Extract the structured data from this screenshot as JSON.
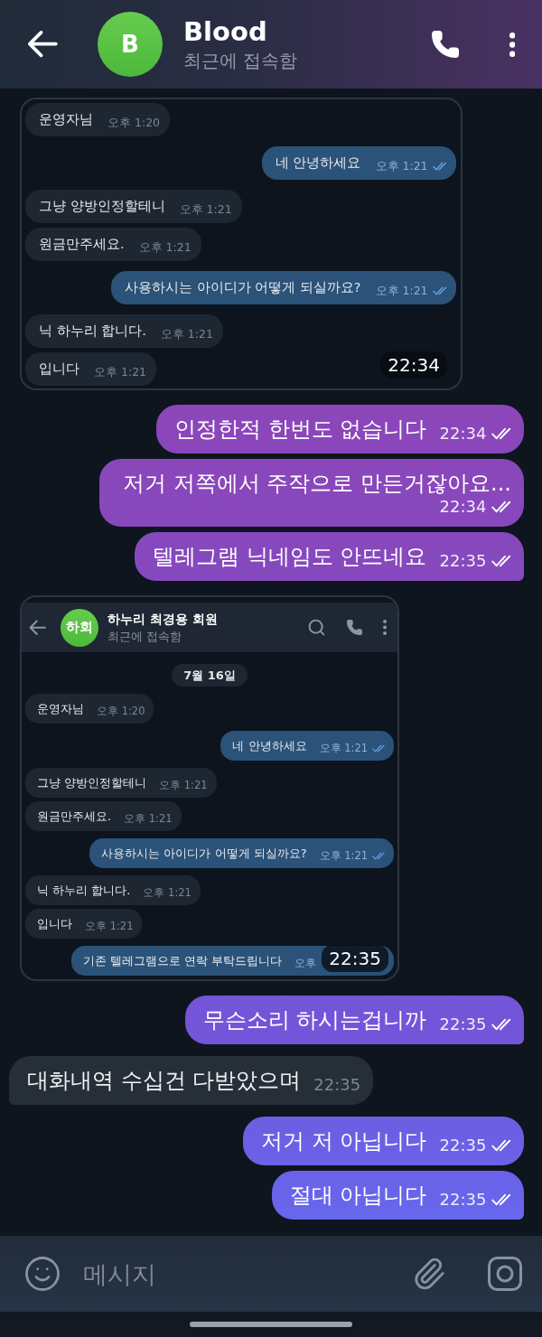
{
  "header": {
    "avatar_initial": "B",
    "title": "Blood",
    "status": "최근에 접속함"
  },
  "messages": [
    {
      "kind": "screenshot",
      "time": "22:34",
      "messages": [
        {
          "kind": "incoming",
          "text": "운영자님",
          "time": "오후 1:20"
        },
        {
          "kind": "outgoing",
          "text": "네 안녕하세요",
          "time": "오후 1:21",
          "read": true
        },
        {
          "kind": "incoming",
          "text": "그냥 양방인정할테니",
          "time": "오후 1:21"
        },
        {
          "kind": "incoming",
          "text": "원금만주세요.",
          "time": "오후 1:21"
        },
        {
          "kind": "outgoing",
          "text": "사용하시는 아이디가 어떻게 되실까요?",
          "time": "오후 1:21",
          "read": true
        },
        {
          "kind": "incoming",
          "text": "닉 하누리 합니다.",
          "time": "오후 1:21"
        },
        {
          "kind": "incoming",
          "text": "입니다",
          "time": "오후 1:21"
        }
      ]
    },
    {
      "kind": "outgoing",
      "text": "인정한적 한번도 없습니다",
      "time": "22:34",
      "read": true
    },
    {
      "kind": "outgoing",
      "text": "저거 저쪽에서 주작으로 만든거잖아요...",
      "time": "22:34",
      "read": true
    },
    {
      "kind": "outgoing",
      "text": "텔레그램 닉네임도 안뜨네요",
      "time": "22:35",
      "read": true
    },
    {
      "kind": "screenshot",
      "time": "22:35",
      "header": {
        "avatar_initial": "하회",
        "title": "하누리 최경용 회원",
        "status": "최근에 접속함"
      },
      "date": "7월 16일",
      "messages": [
        {
          "kind": "incoming",
          "text": "운영자님",
          "time": "오후 1:20"
        },
        {
          "kind": "outgoing",
          "text": "네 안녕하세요",
          "time": "오후 1:21",
          "read": true
        },
        {
          "kind": "incoming",
          "text": "그냥 양방인정할테니",
          "time": "오후 1:21"
        },
        {
          "kind": "incoming",
          "text": "원금만주세요.",
          "time": "오후 1:21"
        },
        {
          "kind": "outgoing",
          "text": "사용하시는 아이디가 어떻게 되실까요?",
          "time": "오후 1:21",
          "read": true
        },
        {
          "kind": "incoming",
          "text": "닉 하누리 합니다.",
          "time": "오후 1:21"
        },
        {
          "kind": "incoming",
          "text": "입니다",
          "time": "오후 1:21"
        },
        {
          "kind": "outgoing",
          "text": "기존 텔레그램으로 연락 부탁드립니다",
          "time": "오후"
        }
      ]
    },
    {
      "kind": "outgoing",
      "text": "무슨소리 하시는겁니까",
      "time": "22:35",
      "read": true
    },
    {
      "kind": "incoming",
      "text": "대화내역 수십건 다받았으며",
      "time": "22:35"
    },
    {
      "kind": "outgoing",
      "text": "저거 저 아닙니다",
      "time": "22:35",
      "read": true
    },
    {
      "kind": "outgoing",
      "text": "절대 아닙니다",
      "time": "22:35",
      "read": true
    }
  ],
  "composer": {
    "placeholder": "메시지"
  }
}
